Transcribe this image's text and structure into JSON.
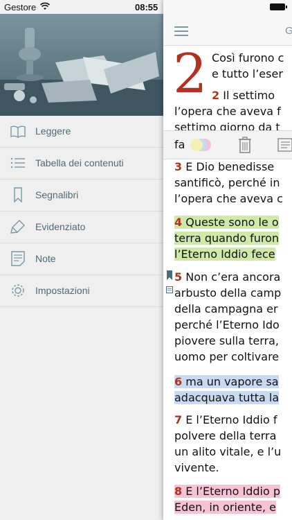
{
  "status_bar": {
    "carrier": "Gestore",
    "time": "08:55"
  },
  "menu": {
    "items": [
      {
        "label": "Leggere",
        "icon": "book-open-icon"
      },
      {
        "label": "Tabella dei contenuti",
        "icon": "list-icon"
      },
      {
        "label": "Segnalibri",
        "icon": "bookmark-icon"
      },
      {
        "label": "Evidenziato",
        "icon": "highlighter-icon"
      },
      {
        "label": "Note",
        "icon": "note-icon"
      },
      {
        "label": "Impostazioni",
        "icon": "gear-icon"
      }
    ]
  },
  "reader": {
    "title": "G",
    "chapter": "2",
    "intro": [
      "Così furono c",
      "e tutto l’eser"
    ],
    "v2": {
      "num": "2",
      "lines": [
        " Il settimo",
        "l’opera che aveva f",
        "settimo giorno da t"
      ]
    },
    "popover_residue": "fa",
    "v3": {
      "num": "3",
      "lines": [
        " E Dio benedisse",
        "santificò, perché in",
        "l’opera che aveva c"
      ]
    },
    "v4": {
      "num": "4",
      "lines": [
        " Queste sono le o",
        "terra quando furon",
        "l’Eterno Iddio fece"
      ]
    },
    "v5": {
      "num": "5",
      "lines": [
        " Non c’era ancora",
        "arbusto della camp",
        "della campagna er",
        "perché l’Eterno Ido",
        "piovere sulla terra,",
        "uomo per coltivare"
      ]
    },
    "v6": {
      "num": "6",
      "lines": [
        " ma un vapore sa",
        "adacquava tutta la"
      ]
    },
    "v7": {
      "num": "7",
      "lines": [
        " E l’Eterno Iddio f",
        "polvere della terra",
        "un alito vitale, e l’u",
        "vivente."
      ]
    },
    "v8": {
      "num": "8",
      "lines": [
        " E l’Eterno Iddio p",
        "Eden, in oriente, e"
      ]
    }
  },
  "colors": {
    "accent": "#4d6a78",
    "verse_number": "#b0321f",
    "highlight_green": "#cfe9a8",
    "highlight_blue": "#c8daf2",
    "highlight_pink": "#f5c2d6"
  }
}
